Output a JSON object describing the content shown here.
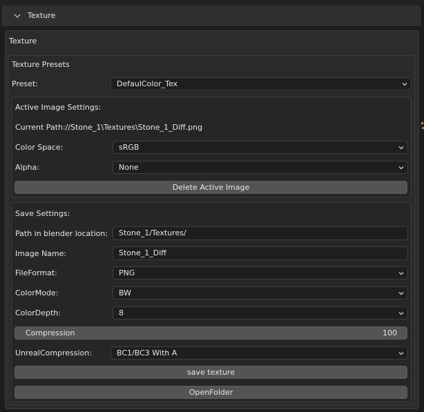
{
  "header": {
    "title": "Texture"
  },
  "panel": {
    "title": "Texture"
  },
  "presets": {
    "title": "Texture Presets",
    "preset_label": "Preset:",
    "preset_value": "DefaulColor_Tex"
  },
  "active": {
    "title": "Active Image Settings:",
    "current_path": "Current Path://Stone_1\\Textures\\Stone_1_Diff.png",
    "color_space_label": "Color Space:",
    "color_space_value": "sRGB",
    "alpha_label": "Alpha:",
    "alpha_value": "None",
    "delete_label": "Delete Active Image"
  },
  "save": {
    "title": "Save Settings:",
    "path_label": "Path in blender location:",
    "path_value": "Stone_1/Textures/",
    "image_name_label": "Image Name:",
    "image_name_value": "Stone_1_Diff",
    "file_format_label": "FileFormat:",
    "file_format_value": "PNG",
    "color_mode_label": "ColorMode:",
    "color_mode_value": "BW",
    "color_depth_label": "ColorDepth:",
    "color_depth_value": "8",
    "compression_label": "Compression",
    "compression_value": "100",
    "unreal_label": "UnrealCompression:",
    "unreal_value": "BC1/BC3 With A",
    "save_button": "save texture",
    "open_folder_button": "OpenFolder"
  },
  "icons": {
    "header_toggle": "chevron-down-icon",
    "dropdown": "chevron-down-icon"
  },
  "colors": {
    "background": "#1d1d1d",
    "panel": "#2c2c2c",
    "field": "#1e1e1e",
    "button": "#545454",
    "text": "#e6e6e6"
  }
}
